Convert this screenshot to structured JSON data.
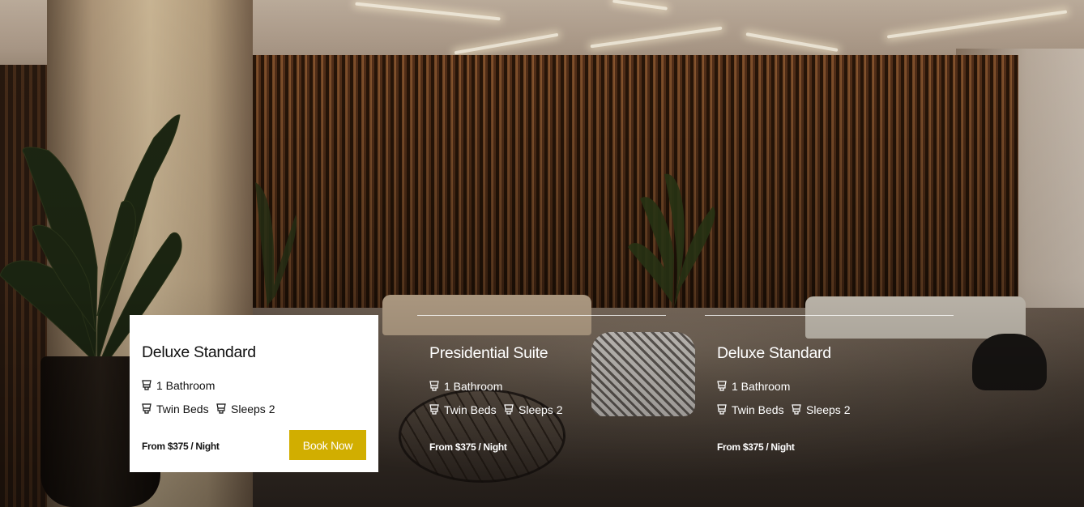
{
  "rooms": [
    {
      "title": "Deluxe Standard",
      "bathroom": "1 Bathroom",
      "beds": "Twin Beds",
      "sleeps": "Sleeps 2",
      "price": "From $375 / Night",
      "cta": "Book Now",
      "state": "active"
    },
    {
      "title": "Presidential Suite",
      "bathroom": "1 Bathroom",
      "beds": "Twin Beds",
      "sleeps": "Sleeps 2",
      "price": "From $375 / Night",
      "state": "inactive"
    },
    {
      "title": "Deluxe Standard",
      "bathroom": "1 Bathroom",
      "beds": "Twin Beds",
      "sleeps": "Sleeps 2",
      "price": "From $375 / Night",
      "state": "inactive"
    }
  ],
  "icons": {
    "feature": "amenity-icon"
  },
  "colors": {
    "accent": "#d1ae00",
    "card_bg": "#ffffff",
    "text_dark": "#111111",
    "text_light": "#ffffff"
  }
}
